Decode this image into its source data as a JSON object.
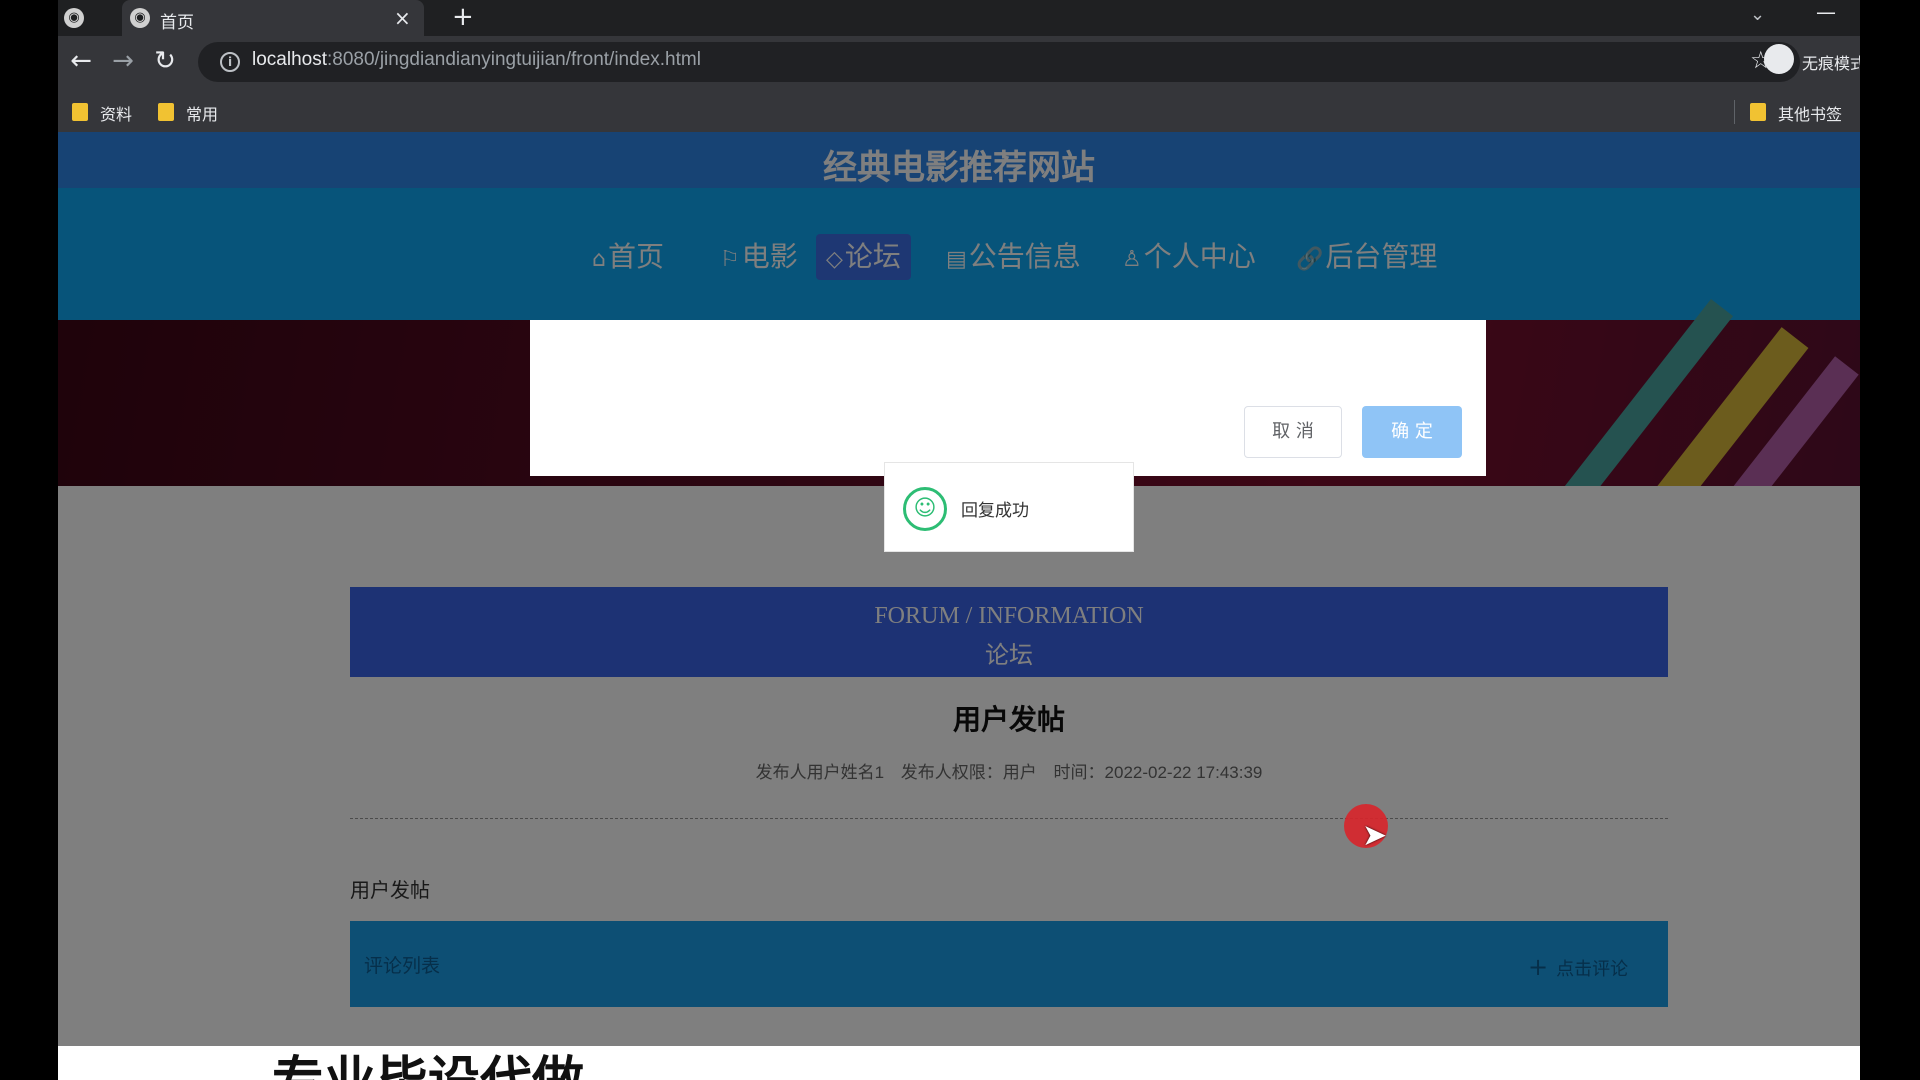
{
  "browser": {
    "tab_title": "首页",
    "tab_close": "×",
    "new_tab": "+",
    "url_host": "localhost",
    "url_path": ":8080/jingdiandianyingtuijian/front/index.html",
    "incognito_label": "无痕模式",
    "bookmarks": [
      {
        "label": "资料"
      },
      {
        "label": "常用"
      },
      {
        "label": "其他书签"
      }
    ]
  },
  "site": {
    "title": "经典电影推荐网站",
    "nav": [
      {
        "label": "首页",
        "icon": "home-icon",
        "glyph": "⌂"
      },
      {
        "label": "电影",
        "icon": "flag-icon",
        "glyph": "⚐"
      },
      {
        "label": "论坛",
        "icon": "tag-icon",
        "glyph": "◇",
        "active": true
      },
      {
        "label": "公告信息",
        "icon": "document-icon",
        "glyph": "▤"
      },
      {
        "label": "个人中心",
        "icon": "user-icon",
        "glyph": "♙"
      },
      {
        "label": "后台管理",
        "icon": "link-icon",
        "glyph": "🔗"
      }
    ],
    "active_color": "#3d6fe6"
  },
  "dialog": {
    "cancel_label": "取 消",
    "confirm_label": "确 定"
  },
  "toast": {
    "message": "回复成功",
    "icon": "smile-icon",
    "color": "#2dbd74"
  },
  "forum": {
    "banner_en": "FORUM / INFORMATION",
    "banner_zh": "论坛",
    "post_title": "用户发帖",
    "meta_author": "发布人用户姓名1",
    "meta_role": "发布人权限：用户",
    "meta_time": "时间：2022-02-22 17:43:39",
    "body": "用户发帖",
    "comment_label": "评论列表",
    "comment_add": "点击评论"
  },
  "bottom_overlay_text": "专业毕设代做"
}
